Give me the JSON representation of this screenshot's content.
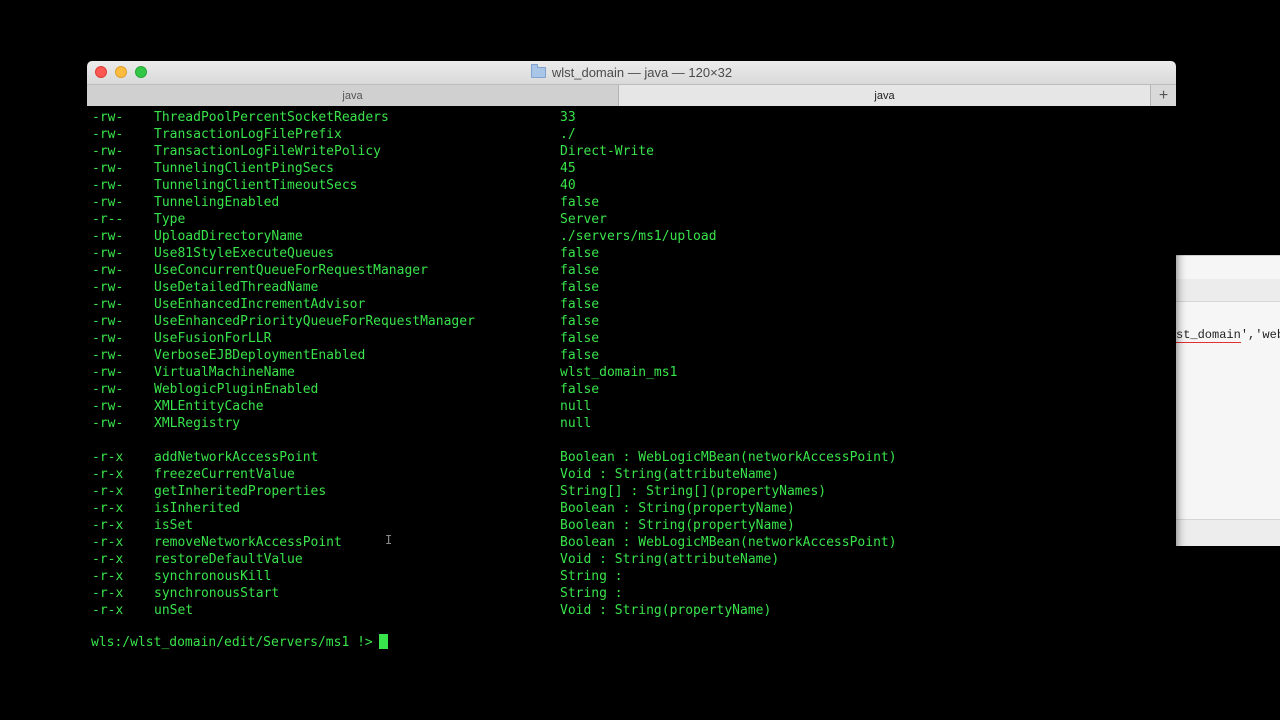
{
  "window": {
    "title": "wlst_domain — java — 120×32",
    "tabs": [
      {
        "label": "java",
        "active": false
      },
      {
        "label": "java",
        "active": true
      }
    ],
    "new_tab_label": "+"
  },
  "background_window": {
    "code_prefix": "st_domain",
    "code_suffix": "','web"
  },
  "terminal": {
    "attributes": [
      {
        "perm": "-rw-",
        "name": "ThreadPoolPercentSocketReaders",
        "value": "33"
      },
      {
        "perm": "-rw-",
        "name": "TransactionLogFilePrefix",
        "value": "./"
      },
      {
        "perm": "-rw-",
        "name": "TransactionLogFileWritePolicy",
        "value": "Direct-Write"
      },
      {
        "perm": "-rw-",
        "name": "TunnelingClientPingSecs",
        "value": "45"
      },
      {
        "perm": "-rw-",
        "name": "TunnelingClientTimeoutSecs",
        "value": "40"
      },
      {
        "perm": "-rw-",
        "name": "TunnelingEnabled",
        "value": "false"
      },
      {
        "perm": "-r--",
        "name": "Type",
        "value": "Server"
      },
      {
        "perm": "-rw-",
        "name": "UploadDirectoryName",
        "value": "./servers/ms1/upload"
      },
      {
        "perm": "-rw-",
        "name": "Use81StyleExecuteQueues",
        "value": "false"
      },
      {
        "perm": "-rw-",
        "name": "UseConcurrentQueueForRequestManager",
        "value": "false"
      },
      {
        "perm": "-rw-",
        "name": "UseDetailedThreadName",
        "value": "false"
      },
      {
        "perm": "-rw-",
        "name": "UseEnhancedIncrementAdvisor",
        "value": "false"
      },
      {
        "perm": "-rw-",
        "name": "UseEnhancedPriorityQueueForRequestManager",
        "value": "false"
      },
      {
        "perm": "-rw-",
        "name": "UseFusionForLLR",
        "value": "false"
      },
      {
        "perm": "-rw-",
        "name": "VerboseEJBDeploymentEnabled",
        "value": "false"
      },
      {
        "perm": "-rw-",
        "name": "VirtualMachineName",
        "value": "wlst_domain_ms1"
      },
      {
        "perm": "-rw-",
        "name": "WeblogicPluginEnabled",
        "value": "false"
      },
      {
        "perm": "-rw-",
        "name": "XMLEntityCache",
        "value": "null"
      },
      {
        "perm": "-rw-",
        "name": "XMLRegistry",
        "value": "null"
      }
    ],
    "operations": [
      {
        "perm": "-r-x",
        "name": "addNetworkAccessPoint",
        "value": "Boolean : WebLogicMBean(networkAccessPoint)"
      },
      {
        "perm": "-r-x",
        "name": "freezeCurrentValue",
        "value": "Void : String(attributeName)"
      },
      {
        "perm": "-r-x",
        "name": "getInheritedProperties",
        "value": "String[] : String[](propertyNames)"
      },
      {
        "perm": "-r-x",
        "name": "isInherited",
        "value": "Boolean : String(propertyName)"
      },
      {
        "perm": "-r-x",
        "name": "isSet",
        "value": "Boolean : String(propertyName)"
      },
      {
        "perm": "-r-x",
        "name": "removeNetworkAccessPoint",
        "value": "Boolean : WebLogicMBean(networkAccessPoint)"
      },
      {
        "perm": "-r-x",
        "name": "restoreDefaultValue",
        "value": "Void : String(attributeName)"
      },
      {
        "perm": "-r-x",
        "name": "synchronousKill",
        "value": "String :"
      },
      {
        "perm": "-r-x",
        "name": "synchronousStart",
        "value": "String :"
      },
      {
        "perm": "-r-x",
        "name": "unSet",
        "value": "Void : String(propertyName)"
      }
    ],
    "prompt": "wls:/wlst_domain/edit/Servers/ms1 !>"
  },
  "colors": {
    "terminal_text": "#39e34b",
    "terminal_bg": "#000000",
    "close": "#fc5753",
    "minimize": "#fdbc40",
    "maximize": "#33c748"
  }
}
